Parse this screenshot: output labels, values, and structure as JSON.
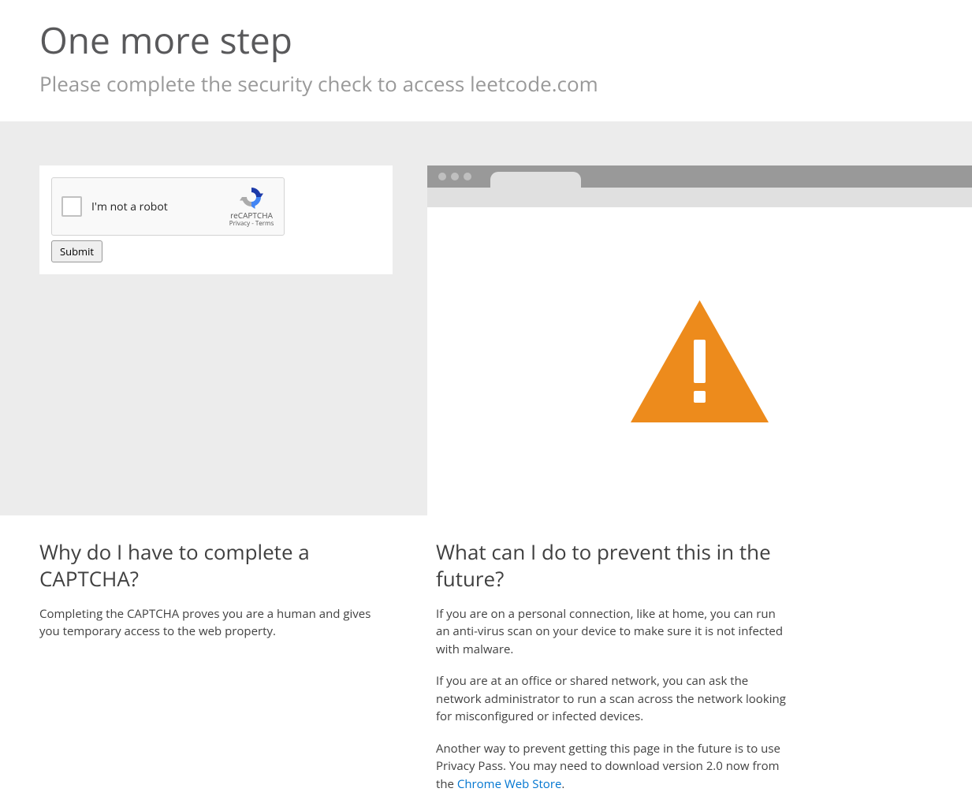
{
  "header": {
    "title": "One more step",
    "subtitle": "Please complete the security check to access leetcode.com"
  },
  "captcha": {
    "checkbox_label": "I'm not a robot",
    "brand": "reCAPTCHA",
    "links": "Privacy - Terms",
    "submit_label": "Submit"
  },
  "info": {
    "left": {
      "heading": "Why do I have to complete a CAPTCHA?",
      "p1": "Completing the CAPTCHA proves you are a human and gives you temporary access to the web property."
    },
    "right": {
      "heading": "What can I do to prevent this in the future?",
      "p1": "If you are on a personal connection, like at home, you can run an anti-virus scan on your device to make sure it is not infected with malware.",
      "p2": "If you are at an office or shared network, you can ask the network administrator to run a scan across the network looking for misconfigured or infected devices.",
      "p3_pre": "Another way to prevent getting this page in the future is to use Privacy Pass. You may need to download version 2.0 now from the ",
      "p3_link": "Chrome Web Store"
    }
  }
}
